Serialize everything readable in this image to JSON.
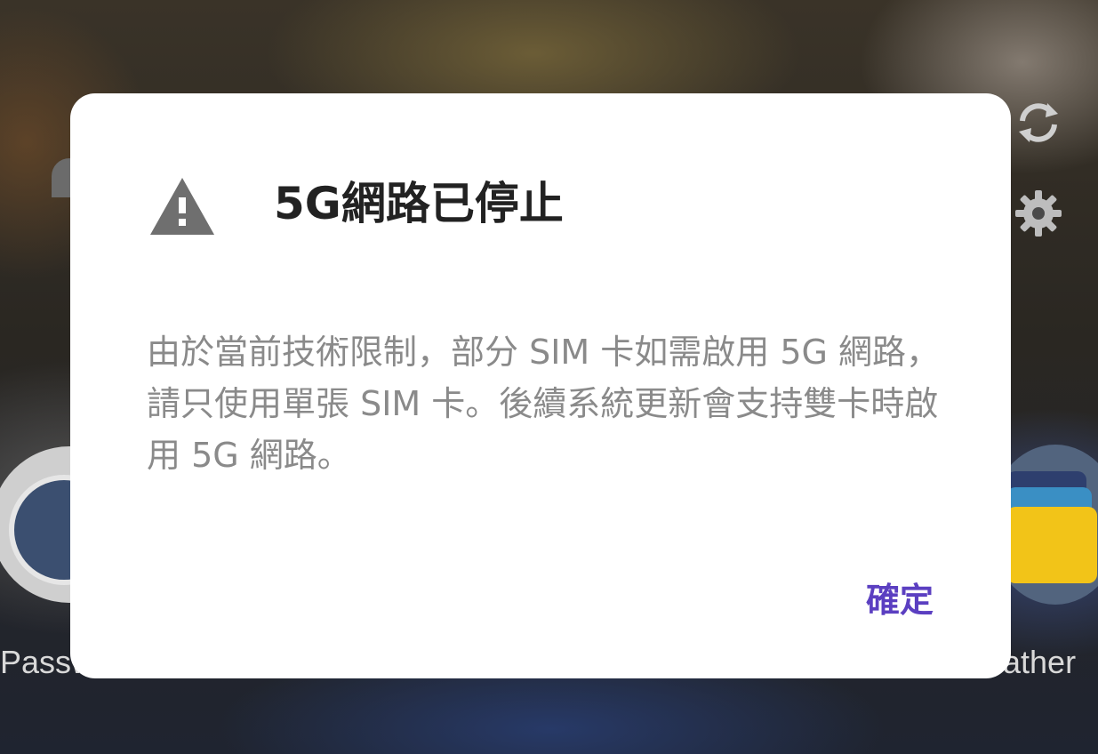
{
  "background": {
    "left_app_label": "Passw",
    "right_app_label": "ather",
    "icons": [
      "sync-icon",
      "gear-icon"
    ]
  },
  "dialog": {
    "icon": "warning-icon",
    "title": "5G網路已停止",
    "message": "由於當前技術限制，部分 SIM 卡如需啟用 5G 網路，請只使用單張 SIM 卡。後續系統更新會支持雙卡時啟用 5G 網路。",
    "confirm_label": "確定"
  },
  "colors": {
    "accent": "#5b3fc1",
    "title_text": "#222222",
    "body_text": "#8a8a8a",
    "warning_icon": "#6f6f6f"
  }
}
